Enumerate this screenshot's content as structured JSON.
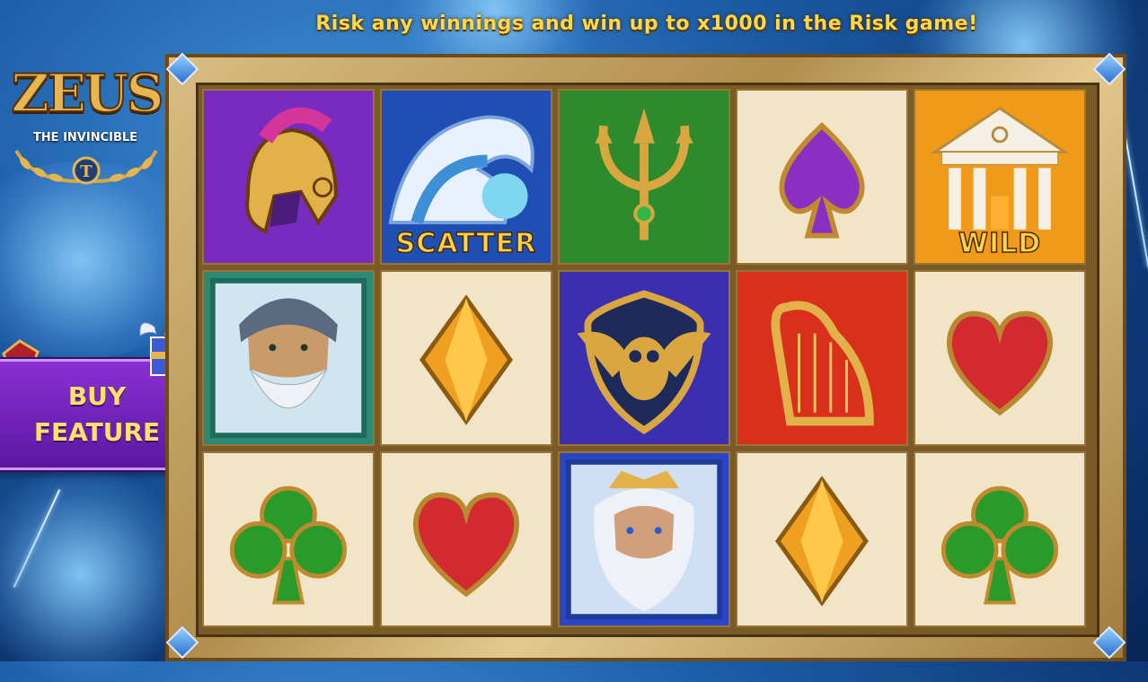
{
  "banner": {
    "text": "Risk any winnings and win up to x1000 in the Risk game!"
  },
  "logo": {
    "title": "ZEUS",
    "subtitle": "THE INVINCIBLE"
  },
  "buy_feature": {
    "label": "BUY\nFEATURE",
    "icon": "winged-gift-icon"
  },
  "colors": {
    "banner": "#ffd84a",
    "buy_bg": "#7424c0",
    "buy_text": "#ffe06b",
    "tile_bg": "#f1e4c7",
    "frame": "#c8a86a"
  },
  "reels": [
    [
      "helmet",
      "zeus-elder",
      "club"
    ],
    [
      "scatter",
      "diamond",
      "heart"
    ],
    [
      "trident",
      "owl-shield",
      "zeus-crowned"
    ],
    [
      "spade",
      "harp",
      "diamond"
    ],
    [
      "wild",
      "heart",
      "club"
    ]
  ],
  "symbol_labels": {
    "scatter": "SCATTER",
    "wild": "WILD"
  }
}
